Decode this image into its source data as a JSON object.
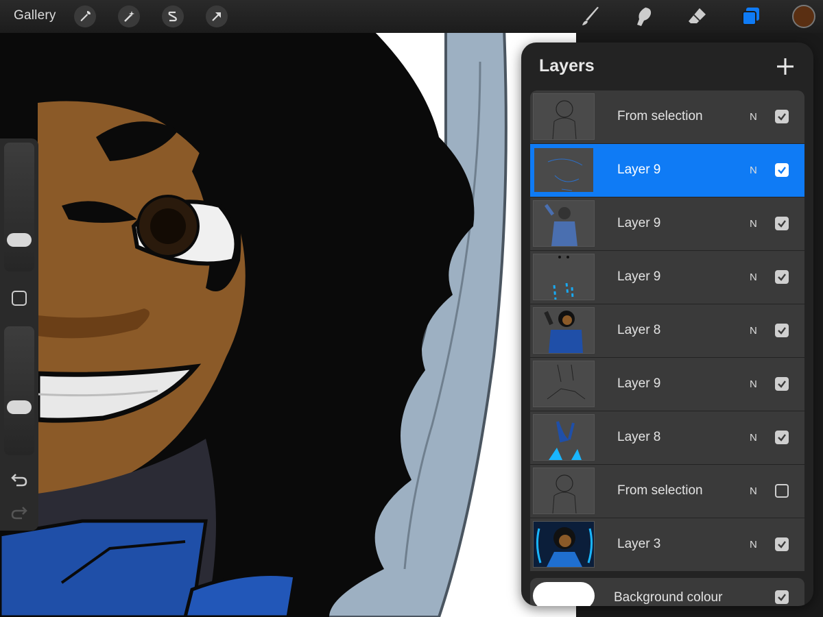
{
  "topbar": {
    "gallery_label": "Gallery",
    "left_tools": [
      "wrench-icon",
      "magic-wand-icon",
      "selection-s-icon",
      "transform-arrow-icon"
    ],
    "right_tools": [
      "brush-icon",
      "smudge-icon",
      "eraser-icon",
      "layers-icon"
    ],
    "active_color": "#5a2f12",
    "active_tool_color": "#0f7bf5"
  },
  "sidebar": {
    "brush_size_level": 0.2,
    "opacity_level": 0.35,
    "icons": [
      "modifier-square-icon",
      "undo-icon",
      "redo-icon"
    ]
  },
  "layers_panel": {
    "title": "Layers",
    "add_icon": "plus-icon",
    "layers": [
      {
        "name": "From selection",
        "blend": "N",
        "visible": true,
        "selected": false,
        "thumb": "sketch"
      },
      {
        "name": "Layer 9",
        "blend": "N",
        "visible": true,
        "selected": true,
        "thumb": "faint-sketch"
      },
      {
        "name": "Layer 9",
        "blend": "N",
        "visible": true,
        "selected": false,
        "thumb": "colored-figure"
      },
      {
        "name": "Layer 9",
        "blend": "N",
        "visible": true,
        "selected": false,
        "thumb": "blue-marks"
      },
      {
        "name": "Layer 8",
        "blend": "N",
        "visible": true,
        "selected": false,
        "thumb": "dark-figure"
      },
      {
        "name": "Layer 9",
        "blend": "N",
        "visible": true,
        "selected": false,
        "thumb": "lines"
      },
      {
        "name": "Layer 8",
        "blend": "N",
        "visible": true,
        "selected": false,
        "thumb": "blue-shapes"
      },
      {
        "name": "From selection",
        "blend": "N",
        "visible": false,
        "selected": false,
        "thumb": "sketch"
      },
      {
        "name": "Layer 3",
        "blend": "N",
        "visible": true,
        "selected": false,
        "thumb": "full-color"
      }
    ],
    "background": {
      "name": "Background colour",
      "visible": true
    }
  },
  "colors": {
    "panel_bg": "#232323",
    "row_bg": "#3a3a3a",
    "selected_row": "#0f7bf5",
    "skin": "#8b5a28",
    "hair": "#0a0a0a",
    "armor": "#1f4fa8",
    "sword": "#9db0c2"
  }
}
